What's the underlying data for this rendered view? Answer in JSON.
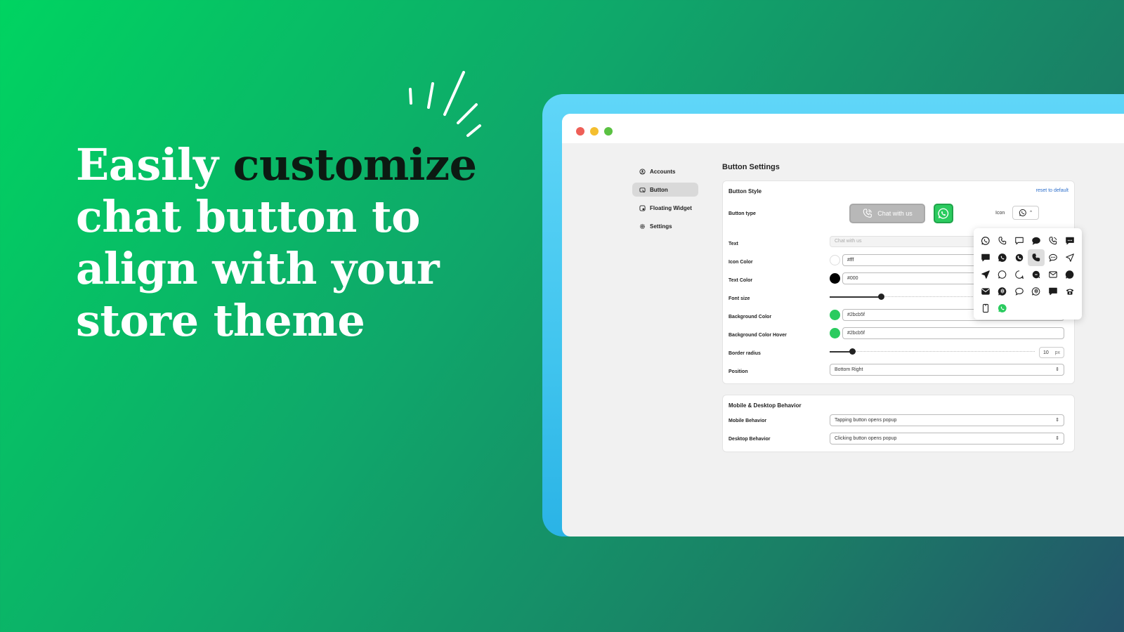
{
  "headline": {
    "part1": "Easily ",
    "highlight": "customize",
    "part2": " chat button to align with your store theme"
  },
  "sidebar": {
    "items": [
      {
        "label": "Accounts",
        "icon": "account-icon",
        "active": false
      },
      {
        "label": "Button",
        "icon": "button-icon",
        "active": true
      },
      {
        "label": "Floating Widget",
        "icon": "widget-icon",
        "active": false
      },
      {
        "label": "Settings",
        "icon": "gear-icon",
        "active": false
      }
    ]
  },
  "main": {
    "title": "Button Settings",
    "button_style": {
      "title": "Button Style",
      "reset_label": "reset to default",
      "button_type_label": "Button type",
      "preview_text": "Chat with us",
      "icon_label": "Icon",
      "text_label": "Text",
      "text_placeholder": "Chat with us",
      "icon_color_label": "Icon Color",
      "icon_color_value": "#fff",
      "text_color_label": "Text Color",
      "text_color_value": "#000",
      "font_size_label": "Font size",
      "font_size_fraction": 0.22,
      "bg_color_label": "Background Color",
      "bg_color_value": "#2bcb5f",
      "bg_hover_label": "Background Color Hover",
      "bg_hover_value": "#2bcb5f",
      "border_radius_label": "Border radius",
      "border_radius_value": "10",
      "border_radius_unit": "px",
      "border_radius_fraction": 0.11,
      "position_label": "Position",
      "position_value": "Bottom Right"
    },
    "behavior": {
      "title": "Mobile & Desktop Behavior",
      "mobile_label": "Mobile Behavior",
      "mobile_value": "Tapping button opens popup",
      "desktop_label": "Desktop Behavior",
      "desktop_value": "Clicking button opens popup"
    }
  },
  "icon_picker": {
    "selected_index": 9,
    "icons": [
      "whatsapp-outline-icon",
      "phone-outline-icon",
      "chat-square-outline-icon",
      "chat-bubble-filled-icon",
      "phone-call-outline-icon",
      "chat-dots-filled-icon",
      "chat-square-filled-icon",
      "whatsapp-filled-icon",
      "phone-circle-filled-icon",
      "phone-filled-icon",
      "chat-dots-outline-icon",
      "send-outline-icon",
      "send-filled-icon",
      "chat-round-outline-icon",
      "chat-swirl-outline-icon",
      "chat-swirl-filled-icon",
      "mail-outline-icon",
      "chat-round-filled-icon",
      "mail-filled-icon",
      "audio-chat-filled-icon",
      "chat-tail-outline-icon",
      "audio-chat-outline-icon",
      "chat-tail-filled-icon",
      "telephone-filled-icon",
      "mobile-icon",
      "whatsapp-green-icon"
    ]
  },
  "colors": {
    "accent": "#2bcb5f",
    "link": "#2c6ecb"
  }
}
